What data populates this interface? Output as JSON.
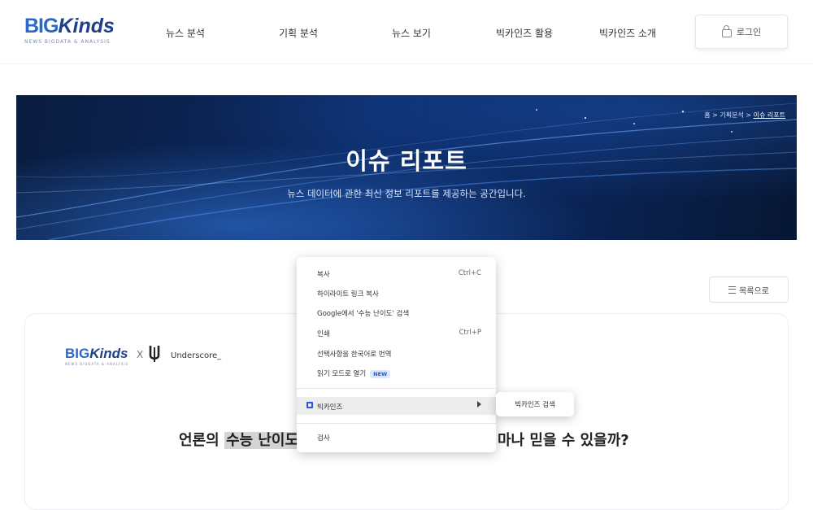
{
  "header": {
    "logo": {
      "big": "BIG",
      "kinds": "Kinds",
      "tagline": "NEWS BIGDATA & ANALYSIS"
    },
    "nav": [
      "뉴스 분석",
      "기획 분석",
      "뉴스 보기",
      "빅카인즈 활용",
      "빅카인즈 소개"
    ],
    "login_label": "로그인"
  },
  "banner": {
    "breadcrumb": {
      "home": "홈",
      "sep": ">",
      "parent": "기획분석",
      "current": "이슈 리포트"
    },
    "title": "이슈 리포트",
    "subtitle": "뉴스 데이터에 관한 최신 정보 리포트를 제공하는 공간입니다."
  },
  "list_button_label": "목록으로",
  "article": {
    "logo": {
      "big": "BIG",
      "kinds": "Kinds",
      "tagline": "NEWS BIGDATA & ANALYSIS"
    },
    "times": "X",
    "partner": "Underscore_",
    "headline": {
      "prefix": "언론의 ",
      "selected": "수능 난이도",
      "suffix": "마나 믿을 수 있을까?"
    }
  },
  "context_menu": {
    "items": [
      {
        "label": "복사",
        "shortcut": "Ctrl+C"
      },
      {
        "label": "하이라이트 링크 복사",
        "shortcut": ""
      },
      {
        "label": "Google에서 '수능 난이도' 검색",
        "shortcut": ""
      },
      {
        "label": "인쇄",
        "shortcut": "Ctrl+P"
      },
      {
        "label": "선택사항을 한국어로 번역",
        "shortcut": ""
      },
      {
        "label": "읽기 모드로 열기",
        "shortcut": "",
        "badge": "NEW"
      }
    ],
    "extension": "빅카인즈",
    "inspect": "검사",
    "submenu_item": "빅카인즈 검색"
  },
  "colors": {
    "brand_blue": "#2b68c8",
    "brand_navy": "#1e3f8a",
    "brand_orange": "#f3a100",
    "banner_dark": "#0a1c3e",
    "badge_blue": "#1a5bd8"
  }
}
